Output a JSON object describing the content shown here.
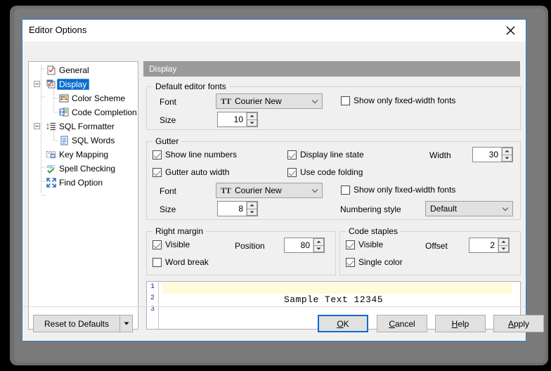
{
  "window": {
    "title": "Editor Options",
    "close_icon": "close-icon"
  },
  "tree": {
    "items": [
      {
        "label": "General",
        "icon": "document-check-icon",
        "level": 0,
        "expander": "none",
        "selected": false
      },
      {
        "label": "Display",
        "icon": "window-check-icon",
        "level": 0,
        "expander": "collapse",
        "selected": true
      },
      {
        "label": "Color Scheme",
        "icon": "color-palette-icon",
        "level": 1,
        "expander": "none",
        "selected": false
      },
      {
        "label": "Code Completion",
        "icon": "code-list-icon",
        "level": 1,
        "expander": "none",
        "selected": false
      },
      {
        "label": "SQL Formatter",
        "icon": "sort-lines-icon",
        "level": 0,
        "expander": "collapse",
        "selected": false
      },
      {
        "label": "SQL Words",
        "icon": "document-lines-icon",
        "level": 1,
        "expander": "none",
        "selected": false
      },
      {
        "label": "Key Mapping",
        "icon": "keyboard-icon",
        "level": 0,
        "expander": "none",
        "selected": false
      },
      {
        "label": "Spell Checking",
        "icon": "abc-check-icon",
        "level": 0,
        "expander": "none",
        "selected": false
      },
      {
        "label": "Find Option",
        "icon": "collapse-arrows-icon",
        "level": 0,
        "expander": "none",
        "selected": false
      }
    ]
  },
  "page": {
    "header": "Display"
  },
  "default_fonts": {
    "group_title": "Default editor fonts",
    "font_label": "Font",
    "font_value": "Courier New",
    "size_label": "Size",
    "size_value": "10",
    "fixed_width_label": "Show only fixed-width fonts",
    "fixed_width_checked": false
  },
  "gutter": {
    "group_title": "Gutter",
    "show_line_numbers_label": "Show line numbers",
    "show_line_numbers_checked": true,
    "gutter_auto_width_label": "Gutter auto width",
    "gutter_auto_width_checked": true,
    "display_line_state_label": "Display line state",
    "display_line_state_checked": true,
    "use_code_folding_label": "Use code folding",
    "use_code_folding_checked": true,
    "width_label": "Width",
    "width_value": "30",
    "font_label": "Font",
    "font_value": "Courier New",
    "size_label": "Size",
    "size_value": "8",
    "fixed_width_label": "Show only fixed-width fonts",
    "fixed_width_checked": false,
    "numbering_style_label": "Numbering style",
    "numbering_style_value": "Default"
  },
  "right_margin": {
    "group_title": "Right margin",
    "visible_label": "Visible",
    "visible_checked": true,
    "word_break_label": "Word break",
    "word_break_checked": false,
    "position_label": "Position",
    "position_value": "80"
  },
  "code_staples": {
    "group_title": "Code staples",
    "visible_label": "Visible",
    "visible_checked": true,
    "single_color_label": "Single color",
    "single_color_checked": true,
    "offset_label": "Offset",
    "offset_value": "2"
  },
  "preview": {
    "line_numbers": [
      "1",
      "2",
      "3"
    ],
    "sample_text": "Sample Text 12345",
    "highlight_color": "#fdfbd8"
  },
  "buttons": {
    "reset": {
      "pre": "R",
      "post": "eset to Defaults"
    },
    "ok": {
      "pre": "O",
      "post": "K"
    },
    "cancel": {
      "pre": "C",
      "post": "ancel"
    },
    "help": {
      "pre": "H",
      "post": "elp"
    },
    "apply": {
      "pre": "A",
      "post": "pply"
    }
  },
  "colors": {
    "accent": "#0a6ccf",
    "header_bar": "#9a9a9a",
    "dialog_bg": "#f0f0f0"
  }
}
